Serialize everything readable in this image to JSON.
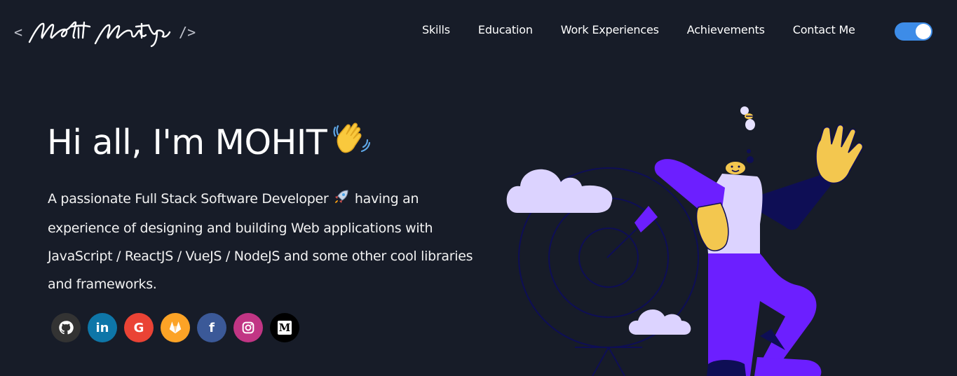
{
  "logo": {
    "open_bracket": "<",
    "close_bracket": "/>",
    "signature_text": "Mohit Mourtiya"
  },
  "nav": {
    "items": [
      {
        "label": "Skills"
      },
      {
        "label": "Education"
      },
      {
        "label": "Work Experiences"
      },
      {
        "label": "Achievements"
      },
      {
        "label": "Contact Me"
      }
    ]
  },
  "theme_toggle": {
    "state": "on",
    "accent": "#3d8ce8"
  },
  "hero": {
    "greeting": "Hi all, I'm MOHIT",
    "wave_icon": "waving-hand-icon",
    "intro_part1": "A passionate Full Stack Software Developer",
    "rocket_icon": "rocket-icon",
    "intro_part2": "having an experience of designing and building Web applications with JavaScript / ReactJS / VueJS / NodeJS and some other cool libraries and frameworks."
  },
  "social": [
    {
      "name": "github-icon",
      "glyph": "",
      "color": "#333333"
    },
    {
      "name": "linkedin-icon",
      "glyph": "in",
      "color": "#0e76a8"
    },
    {
      "name": "google-icon",
      "glyph": "G",
      "color": "#ea4335"
    },
    {
      "name": "gitlab-icon",
      "glyph": "",
      "color": "#fca326"
    },
    {
      "name": "facebook-icon",
      "glyph": "f",
      "color": "#3b5998"
    },
    {
      "name": "instagram-icon",
      "glyph": "",
      "color": "#c13584"
    },
    {
      "name": "medium-icon",
      "glyph": "M",
      "color": "#000000"
    }
  ],
  "colors": {
    "background": "#171c28",
    "purple": "#6c1fff",
    "lavender": "#dcd3ff",
    "skin": "#f3c74f"
  }
}
